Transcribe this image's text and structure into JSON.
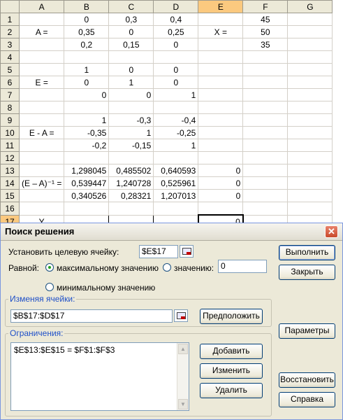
{
  "sheet": {
    "columns": [
      "A",
      "B",
      "C",
      "D",
      "E",
      "F",
      "G"
    ],
    "rows": [
      "1",
      "2",
      "3",
      "4",
      "5",
      "6",
      "7",
      "8",
      "9",
      "10",
      "11",
      "12",
      "13",
      "14",
      "15",
      "16",
      "17"
    ],
    "cells": {
      "B1": "0",
      "C1": "0,3",
      "D1": "0,4",
      "F1": "45",
      "A2": "A =",
      "B2": "0,35",
      "C2": "0",
      "D2": "0,25",
      "E2": "X =",
      "F2": "50",
      "B3": "0,2",
      "C3": "0,15",
      "D3": "0",
      "F3": "35",
      "B5": "1",
      "C5": "0",
      "D5": "0",
      "A6": "E =",
      "B6": "0",
      "C6": "1",
      "D6": "0",
      "B7": "0",
      "C7": "0",
      "D7": "1",
      "B9": "1",
      "C9": "-0,3",
      "D9": "-0,4",
      "A10": "E - A =",
      "B10": "-0,35",
      "C10": "1",
      "D10": "-0,25",
      "B11": "-0,2",
      "C11": "-0,15",
      "D11": "1",
      "B13": "1,298045",
      "C13": "0,485502",
      "D13": "0,640593",
      "E13": "0",
      "A14": "(E – A)⁻¹ =",
      "B14": "0,539447",
      "C14": "1,240728",
      "D14": "0,525961",
      "E14": "0",
      "B15": "0,340526",
      "C15": "0,28321",
      "D15": "1,207013",
      "E15": "0",
      "A17": "Y",
      "E17": "0"
    },
    "active_cell": "E17",
    "active_column": "E",
    "active_row": "17"
  },
  "dialog": {
    "title": "Поиск решения",
    "target_label": "Установить целевую ячейку:",
    "target_value": "$E$17",
    "equal_label": "Равной:",
    "opt_max": "максимальному значению",
    "opt_value": "значению:",
    "value_field": "0",
    "opt_min": "минимальному значению",
    "changing_label": "Изменяя ячейки:",
    "changing_value": "$B$17:$D$17",
    "guess_button": "Предположить",
    "constraints_label": "Ограничения:",
    "constraint_1": "$E$13:$E$15 = $F$1:$F$3",
    "add_button": "Добавить",
    "change_button": "Изменить",
    "delete_button": "Удалить",
    "solve_button": "Выполнить",
    "close_button": "Закрыть",
    "options_button": "Параметры",
    "reset_button": "Восстановить",
    "help_button": "Справка",
    "selected_option": "max"
  }
}
